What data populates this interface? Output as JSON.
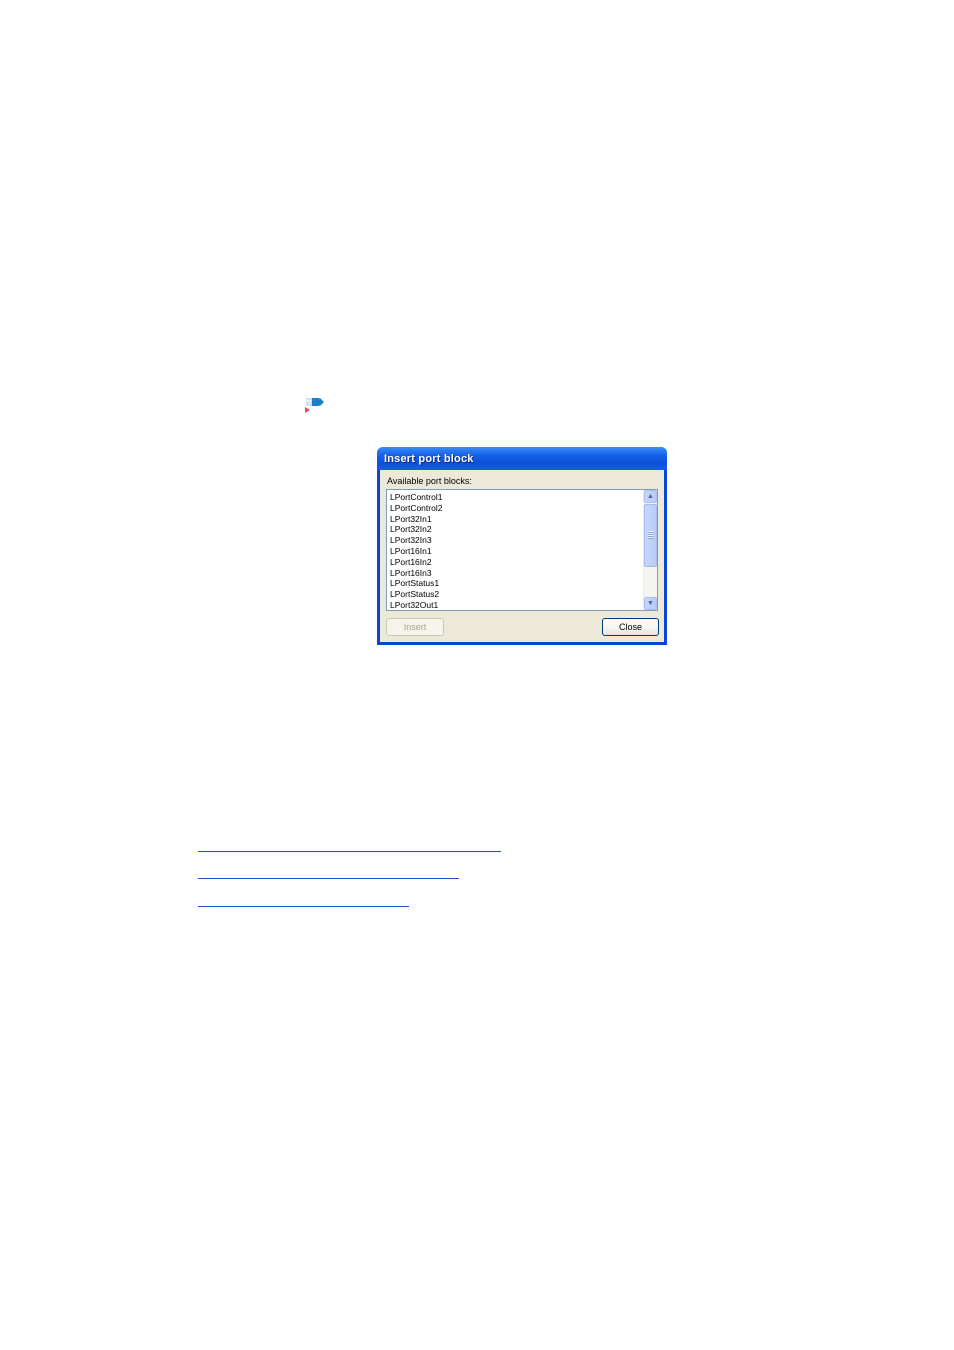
{
  "dialog": {
    "title": "Insert port block",
    "list_label": "Available port blocks:",
    "items": [
      "LPortControl1",
      "LPortControl2",
      "LPort32In1",
      "LPort32In2",
      "LPort32In3",
      "LPort16In1",
      "LPort16In2",
      "LPort16In3",
      "LPortStatus1",
      "LPortStatus2",
      "LPort32Out1"
    ],
    "insert_label": "Insert",
    "close_label": "Close"
  },
  "icons": {
    "port_block": "port-block-icon",
    "scroll_up": "▲",
    "scroll_down": "▼"
  },
  "colors": {
    "titlebar": "#0c50d8",
    "link": "#1a56c9"
  }
}
